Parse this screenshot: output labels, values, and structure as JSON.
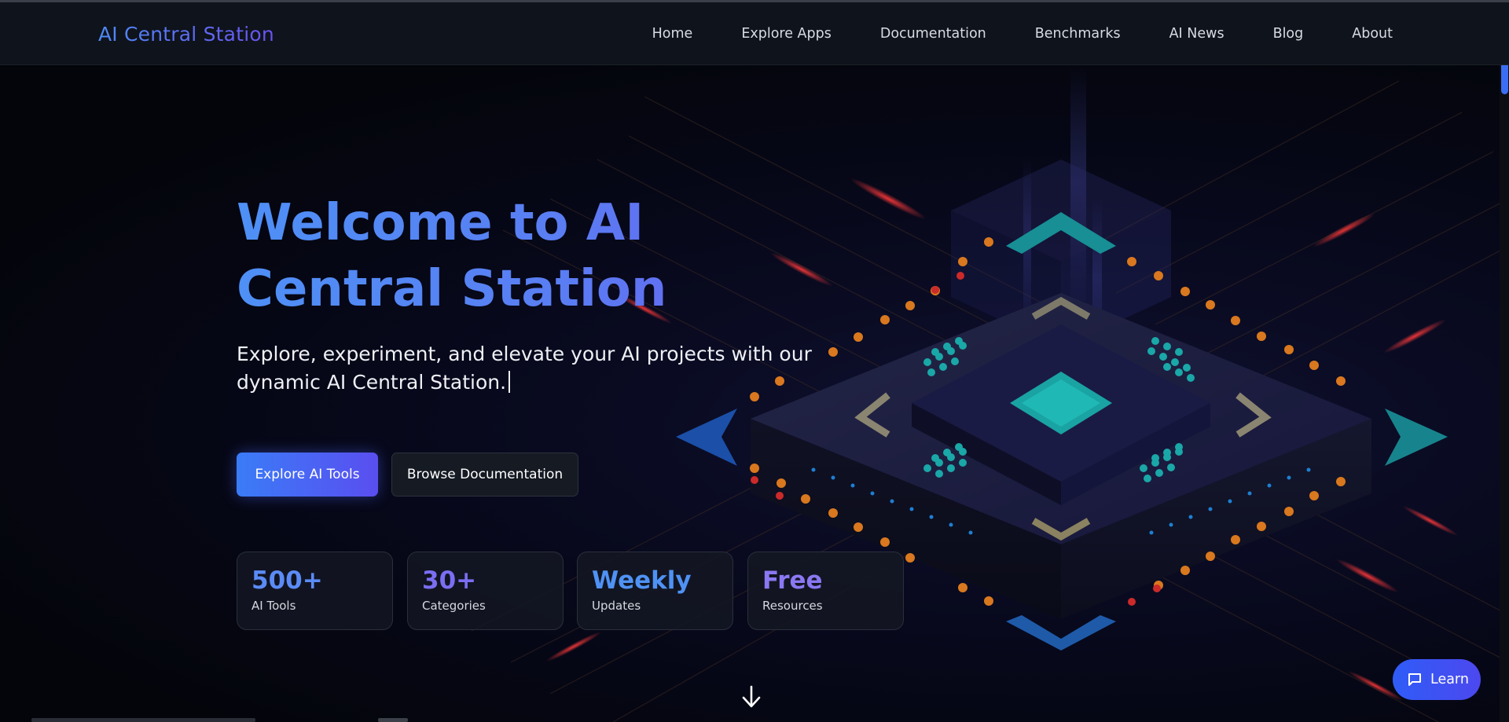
{
  "nav": {
    "brand": "AI Central Station",
    "links": [
      "Home",
      "Explore Apps",
      "Documentation",
      "Benchmarks",
      "AI News",
      "Blog",
      "About"
    ]
  },
  "hero": {
    "title": "Welcome to AI Central Station",
    "subtitle": "Explore, experiment, and elevate your AI projects with our dynamic AI Central Station.",
    "primary_button": "Explore AI Tools",
    "secondary_button": "Browse Documentation",
    "stats": [
      {
        "value": "500+",
        "label": "AI Tools",
        "color": "#5b8bf6"
      },
      {
        "value": "30+",
        "label": "Categories",
        "color": "#7b6ef2"
      },
      {
        "value": "Weekly",
        "label": "Updates",
        "color": "#4f92f5"
      },
      {
        "value": "Free",
        "label": "Resources",
        "color": "#8a78f2"
      }
    ],
    "scroll_icon": "arrow-down-icon"
  },
  "chat": {
    "label": "Learn",
    "icon": "chat-icon"
  },
  "colors": {
    "accent_blue": "#3a7cf7",
    "accent_purple": "#5a4ef0",
    "teal": "#1fb7b6",
    "orange": "#e27a1d",
    "red": "#e23a3a"
  }
}
